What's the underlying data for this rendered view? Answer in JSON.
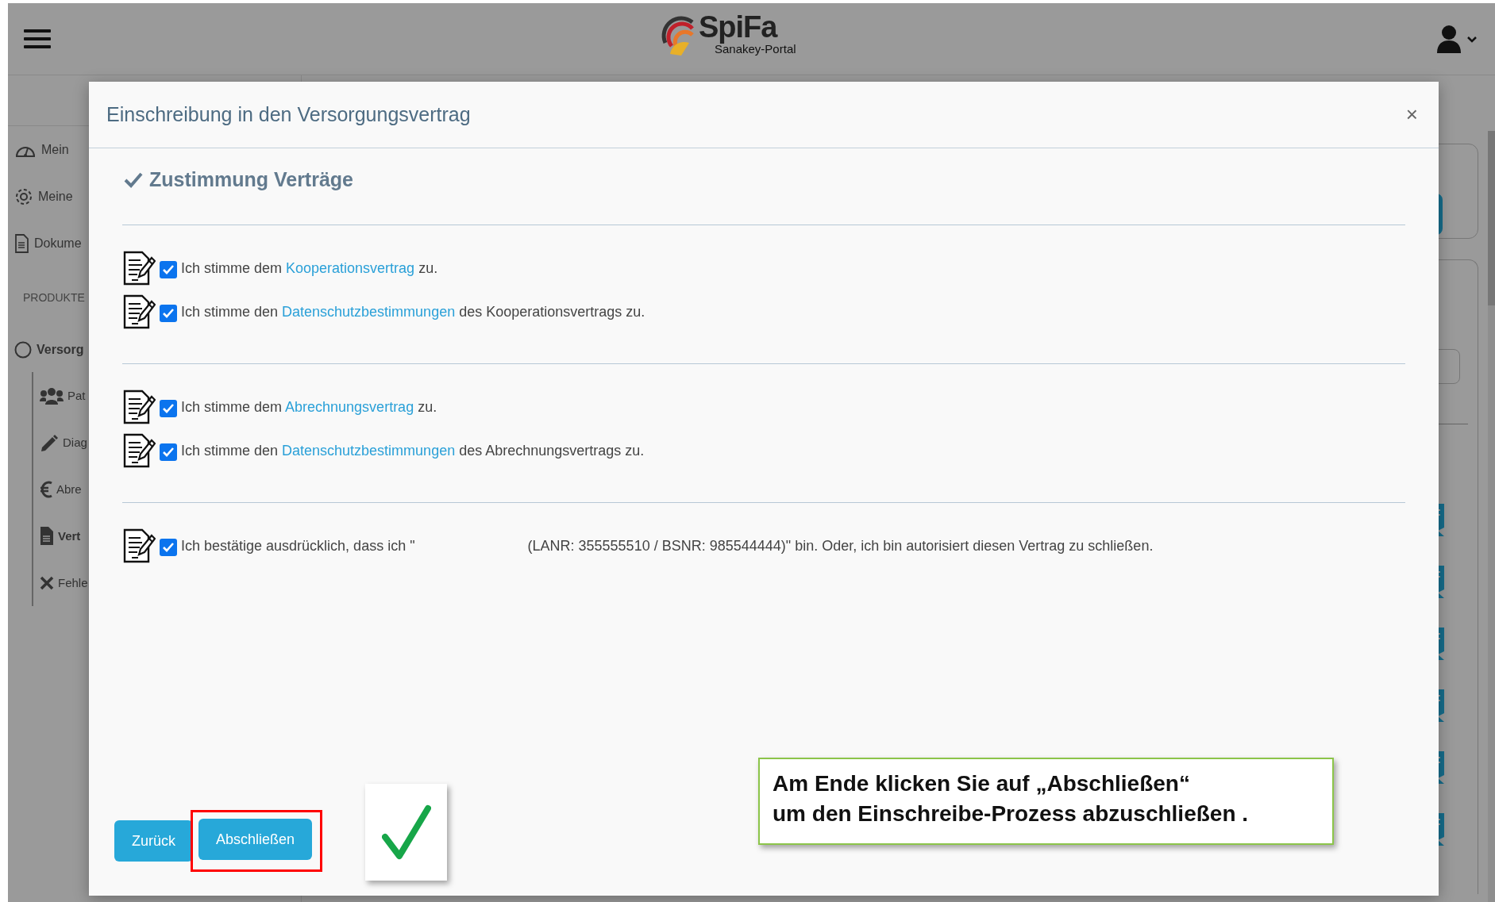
{
  "header": {
    "logo_title": "SpiFa",
    "logo_subtitle": "Sanakey-Portal"
  },
  "sidebar": {
    "items": [
      {
        "label": "Mein"
      },
      {
        "label": "Meine"
      },
      {
        "label": "Dokume"
      }
    ],
    "section": "PRODUKTE",
    "product": {
      "label": "Versorg",
      "children": [
        {
          "label": "Pat",
          "selected": false
        },
        {
          "label": "Diag",
          "selected": false
        },
        {
          "label": "Abre",
          "selected": false
        },
        {
          "label": "Vert",
          "selected": true
        },
        {
          "label": "Fehle",
          "selected": false
        }
      ]
    }
  },
  "dialog": {
    "title": "Einschreibung in den Versorgungsvertrag",
    "close": "×",
    "heading": "Zustimmung Verträge",
    "groups": [
      {
        "rows": [
          {
            "kind": "link",
            "checked": true,
            "before": "Ich stimme dem",
            "link": "Kooperationsvertrag",
            "after": "zu."
          },
          {
            "kind": "link",
            "checked": true,
            "before": "Ich stimme den",
            "link": "Datenschutzbestimmungen",
            "after": "des Kooperationsvertrags zu."
          }
        ]
      },
      {
        "rows": [
          {
            "kind": "link",
            "checked": true,
            "before": "Ich stimme dem",
            "link": "Abrechnungsvertrag",
            "after": "zu."
          },
          {
            "kind": "link",
            "checked": true,
            "before": "Ich stimme den",
            "link": "Datenschutzbestimmungen",
            "after": "des Abrechnungsvertrags zu."
          }
        ]
      },
      {
        "rows": [
          {
            "kind": "redacted",
            "checked": true,
            "before": "Ich bestätige ausdrücklich, dass ich \"",
            "after": "(LANR: 355555510 / BSNR: 985544444)\" bin. Oder, ich bin autorisiert diesen Vertrag zu schließen."
          }
        ]
      }
    ],
    "buttons": [
      {
        "label": "Zurück",
        "highlighted": false
      },
      {
        "label": "Abschließen",
        "highlighted": true
      }
    ]
  },
  "callout": {
    "text": "Am Ende klicken Sie auf „Abschließen“\num den Einschreibe-Prozess abzuschließen ."
  }
}
